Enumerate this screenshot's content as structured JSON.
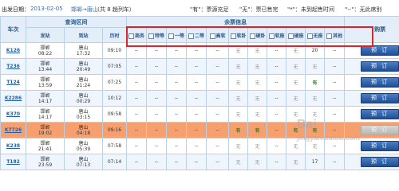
{
  "info_bar": {
    "date_label": "出发日期：",
    "date": "2013-02-05",
    "route": "邯郸→唐山",
    "count": "（共 8 趟列车）",
    "legend": [
      {
        "mark": "\"有\"",
        "text": "：票源充足"
      },
      {
        "mark": "\"无\"",
        "text": "：票已售完"
      },
      {
        "mark": "\"*\"",
        "text": "：未到起售时间"
      },
      {
        "mark": "\"--\"",
        "text": "：无此席别"
      }
    ]
  },
  "table": {
    "header1": {
      "train": "车次",
      "section": "查询区间",
      "seats": "余票信息",
      "buy": "购票"
    },
    "header2": {
      "from": "发站",
      "to": "到站",
      "duration": "历时",
      "seat_types": [
        "商务",
        "特等",
        "一等",
        "二等",
        "高软",
        "软卧",
        "硬卧",
        "软座",
        "硬座",
        "无座",
        "其他"
      ]
    },
    "rows": [
      {
        "train": "K126",
        "from": "邯郸",
        "dep": "08:22",
        "to": "唐山",
        "arr": "17:32",
        "duration": "09:10",
        "seats": [
          "--",
          "--",
          "--",
          "--",
          "--",
          "无",
          "无",
          "--",
          "无",
          "20",
          "--"
        ],
        "buy": "预 订",
        "style": "normal"
      },
      {
        "train": "T236",
        "from": "邯郸",
        "dep": "13:44",
        "to": "唐山",
        "arr": "20:49",
        "duration": "07:05",
        "seats": [
          "--",
          "--",
          "--",
          "--",
          "--",
          "无",
          "无",
          "--",
          "无",
          "无",
          "--"
        ],
        "buy": "预 订",
        "style": "alt"
      },
      {
        "train": "T124",
        "from": "邯郸",
        "dep": "13:59",
        "to": "唐山",
        "arr": "21:24",
        "duration": "07:25",
        "seats": [
          "--",
          "--",
          "--",
          "--",
          "--",
          "无",
          "无",
          "--",
          "无",
          "有",
          "--"
        ],
        "buy": "预 订",
        "style": "normal"
      },
      {
        "train": "K2286",
        "from": "邯郸",
        "dep": "14:17",
        "to": "唐山",
        "arr": "00:29",
        "duration": "10:12",
        "seats": [
          "--",
          "--",
          "--",
          "--",
          "--",
          "无",
          "无",
          "--",
          "无",
          "无",
          "--"
        ],
        "buy": "预 订",
        "style": "alt"
      },
      {
        "train": "K370",
        "from": "邯郸",
        "dep": "14:17",
        "to": "唐山",
        "arr": "03:15",
        "duration": "09:58",
        "seats": [
          "--",
          "--",
          "--",
          "--",
          "--",
          "无",
          "无",
          "--",
          "无",
          "无",
          "--"
        ],
        "buy": "预 订",
        "style": "normal"
      },
      {
        "train": "K7726",
        "from": "邯郸",
        "dep": "19:02",
        "to": "唐山",
        "arr": "04:18",
        "duration": "09:16",
        "seats": [
          "--",
          "--",
          "--",
          "--",
          "--",
          "有",
          "有",
          "--",
          "有",
          "有",
          "--"
        ],
        "buy": "预 订",
        "style": "highlight"
      },
      {
        "train": "K238",
        "from": "邯郸",
        "dep": "21:41",
        "to": "唐山",
        "arr": "05:39",
        "duration": "07:58",
        "seats": [
          "--",
          "--",
          "--",
          "--",
          "--",
          "无",
          "无",
          "--",
          "无",
          "无",
          "--"
        ],
        "buy": "预 订",
        "style": "normal"
      },
      {
        "train": "T182",
        "from": "邯郸",
        "dep": "23:59",
        "to": "唐山",
        "arr": "07:13",
        "duration": "07:14",
        "seats": [
          "--",
          "--",
          "--",
          "--",
          "--",
          "无",
          "无",
          "--",
          "无",
          "17",
          "--"
        ],
        "buy": "预 订",
        "style": "alt"
      }
    ]
  },
  "watermark": {
    "line1": "Bai",
    "line2": "jingyan.baidu.com"
  },
  "colors": {
    "accent": "#1f5fb0",
    "highlight_row": "#f7a06f",
    "red_box": "#d9242b",
    "available": "#1f8f1f"
  }
}
